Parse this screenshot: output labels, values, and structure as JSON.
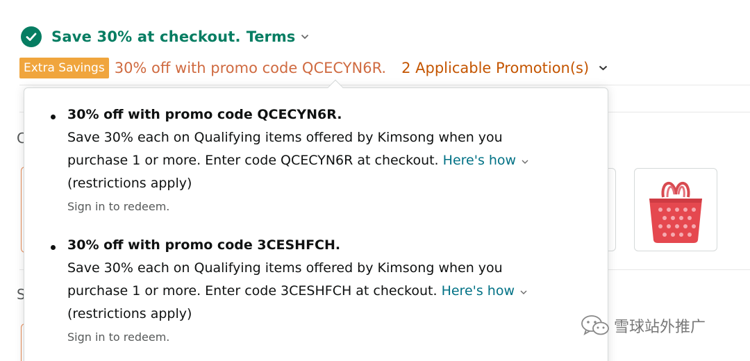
{
  "checkout": {
    "text": "Save 30% at checkout.",
    "terms": "Terms"
  },
  "savings": {
    "badge": "Extra Savings",
    "promo_text": "30% off with promo code QCECYN6R.",
    "promotions_link": "2 Applicable Promotion(s)"
  },
  "background": {
    "char1": "C",
    "char2": "S"
  },
  "popover": {
    "promotions": [
      {
        "title": "30% off with promo code QCECYN6R.",
        "line1": "Save 30% each on Qualifying items offered by Kimsong when you",
        "line2": "purchase 1 or more. Enter code QCECYN6R at checkout.",
        "link": "Here's how",
        "line3": "(restrictions apply)",
        "sign_in": "Sign in to redeem."
      },
      {
        "title": "30% off with promo code 3CESHFCH.",
        "line1": "Save 30% each on Qualifying items offered by Kimsong when you",
        "line2": "purchase 1 or more. Enter code 3CESHFCH at checkout.",
        "link": "Here's how",
        "line3": "(restrictions apply)",
        "sign_in": "Sign in to redeem."
      }
    ]
  },
  "product_thumb": {
    "icon": "tote-bag-icon",
    "color": "#e5484f"
  },
  "watermark": {
    "text": "雪球站外推广",
    "icon": "wechat-icon"
  },
  "colors": {
    "success": "#067d62",
    "badge": "#f0a53d",
    "promo": "#c45500",
    "link": "#007185"
  }
}
